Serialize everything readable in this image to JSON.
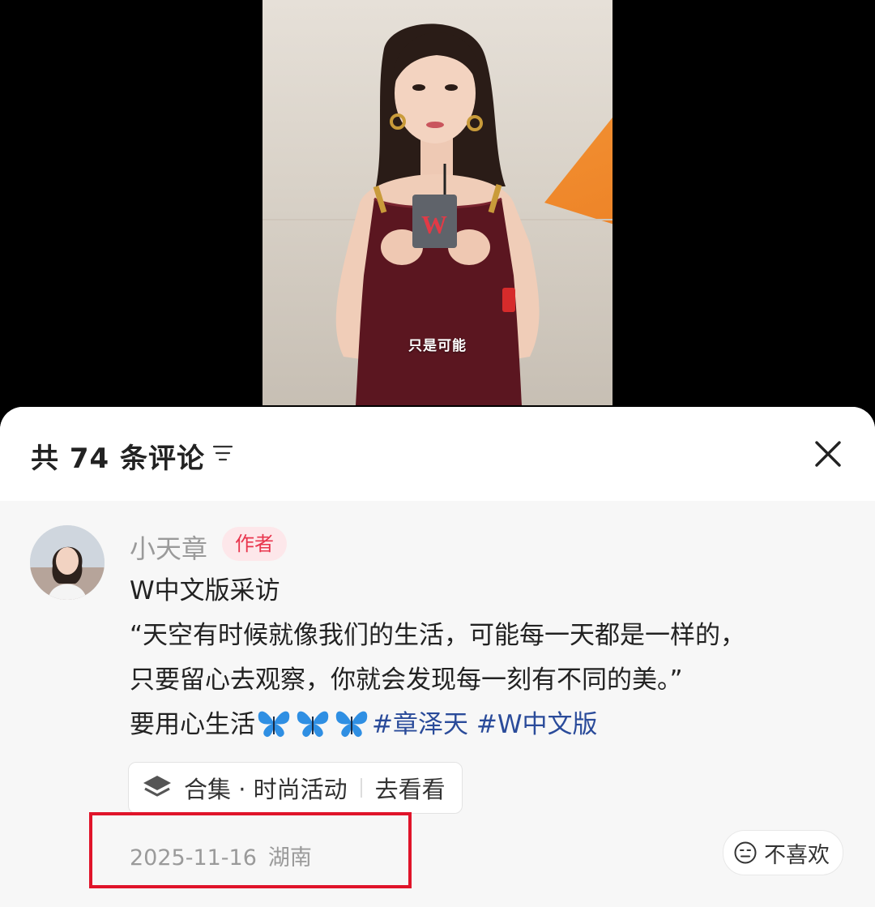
{
  "video": {
    "subtitle": "只是可能",
    "mic_logo_letter": "W"
  },
  "comments": {
    "count_title": "共 74 条评论"
  },
  "comment": {
    "author_name": "小天章",
    "author_badge": "作者",
    "line1": "W中文版采访",
    "line2": "“天空有时候就像我们的生活，可能每一天都是一样的，",
    "line3": "只要留心去观察，你就会发现每一刻有不同的美。”",
    "line4_text": "要用心生活",
    "hashtag1": "#章泽天",
    "hashtag2": "#W中文版",
    "collection_label": "合集 · 时尚活动",
    "collection_action": "去看看",
    "date": "2025-11-16",
    "location": "湖南",
    "dislike_label": "不喜欢"
  },
  "colors": {
    "badge_text": "#e9364e",
    "hashtag": "#2a4b9a",
    "highlight_box": "#e0142a"
  }
}
